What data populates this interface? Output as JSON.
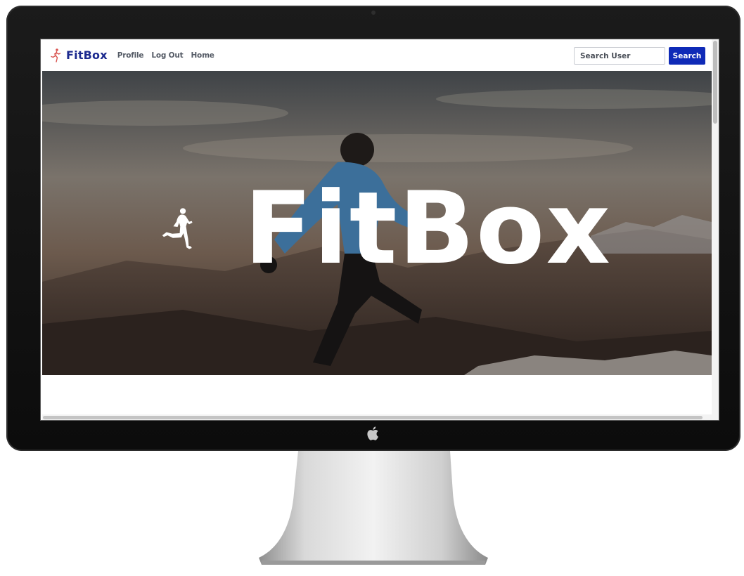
{
  "navbar": {
    "brand": "FitBox",
    "links": [
      "Profile",
      "Log Out",
      "Home"
    ],
    "search": {
      "placeholder": "Search User",
      "value": ""
    },
    "search_button": "Search"
  },
  "hero": {
    "title": "FitBox"
  },
  "colors": {
    "brand": "#1c2a8f",
    "button": "#0f2ab7",
    "brand_icon": "#d9534f",
    "hero_text": "#ffffff"
  },
  "icons": {
    "brand": "running-man-icon",
    "hero": "running-man-icon",
    "device": "apple-logo-icon"
  }
}
